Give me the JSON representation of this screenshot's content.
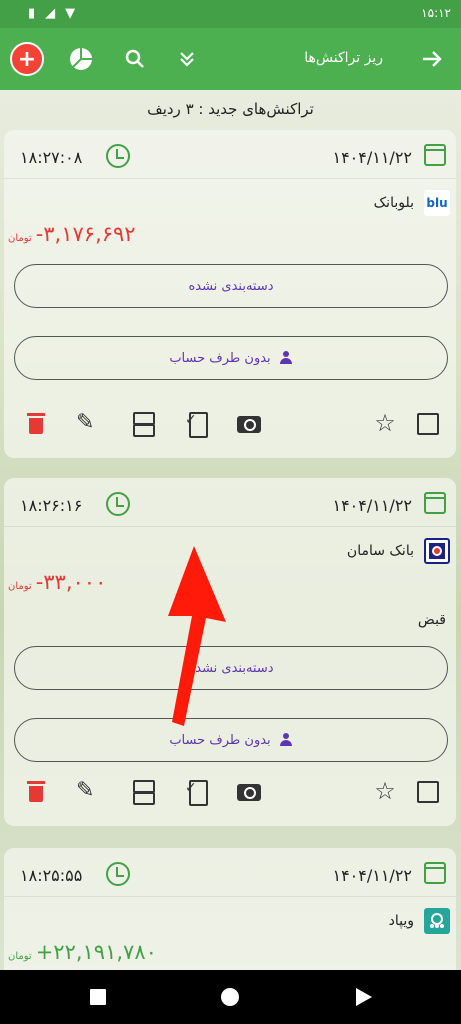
{
  "status_bar": {
    "time": "۱۵:۱۲"
  },
  "app_bar": {
    "title": "ریز تراکنش‌ها",
    "add_label": "+"
  },
  "summary": "تراکنش‌های جدید : ۳ ردیف",
  "transactions": [
    {
      "time": "۱۸:۲۷:۰۸",
      "date": "۱۴۰۴/۱۱/۲۲",
      "bank": "بلوبانک",
      "bank_logo_text": "blu",
      "amount": "-۳,۱۷۶,۶۹۲",
      "unit": "تومان",
      "description": "",
      "category": "دسته‌بندی نشده",
      "party": "بدون طرف حساب"
    },
    {
      "time": "۱۸:۲۶:۱۶",
      "date": "۱۴۰۴/۱۱/۲۲",
      "bank": "بانک سامان",
      "bank_logo_text": "",
      "amount": "-۳۳,۰۰۰",
      "unit": "تومان",
      "description": "قبض",
      "category": "دسته‌بندی نشده",
      "party": "بدون طرف حساب"
    },
    {
      "time": "۱۸:۲۵:۵۵",
      "date": "۱۴۰۴/۱۱/۲۲",
      "bank": "ویپاد",
      "bank_logo_text": "",
      "amount": "+۲۲,۱۹۱,۷۸۰",
      "unit": "تومان",
      "description": "",
      "category": "",
      "party": ""
    }
  ],
  "colors": {
    "primary": "#4caf50",
    "negative": "#e53935",
    "positive": "#43a047",
    "accent": "#5e35b1"
  }
}
